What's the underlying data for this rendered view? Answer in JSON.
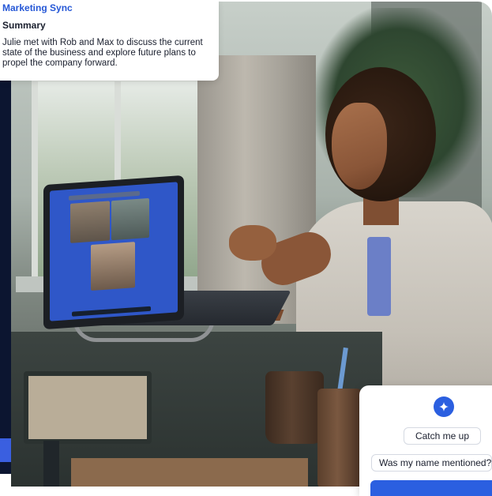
{
  "summary_card": {
    "title": "Marketing Sync",
    "heading": "Summary",
    "body": "Julie met with Rob and Max to discuss the current state of the business and explore future plans to propel the company forward."
  },
  "ai_panel": {
    "icon": "sparkle-icon",
    "suggestions": [
      "Catch me up",
      "Was my name mentioned?"
    ]
  },
  "colors": {
    "accent_blue": "#2b5fe0",
    "title_blue": "#2557d6",
    "navy": "#0c1530",
    "text_dark": "#1a1f2e"
  }
}
